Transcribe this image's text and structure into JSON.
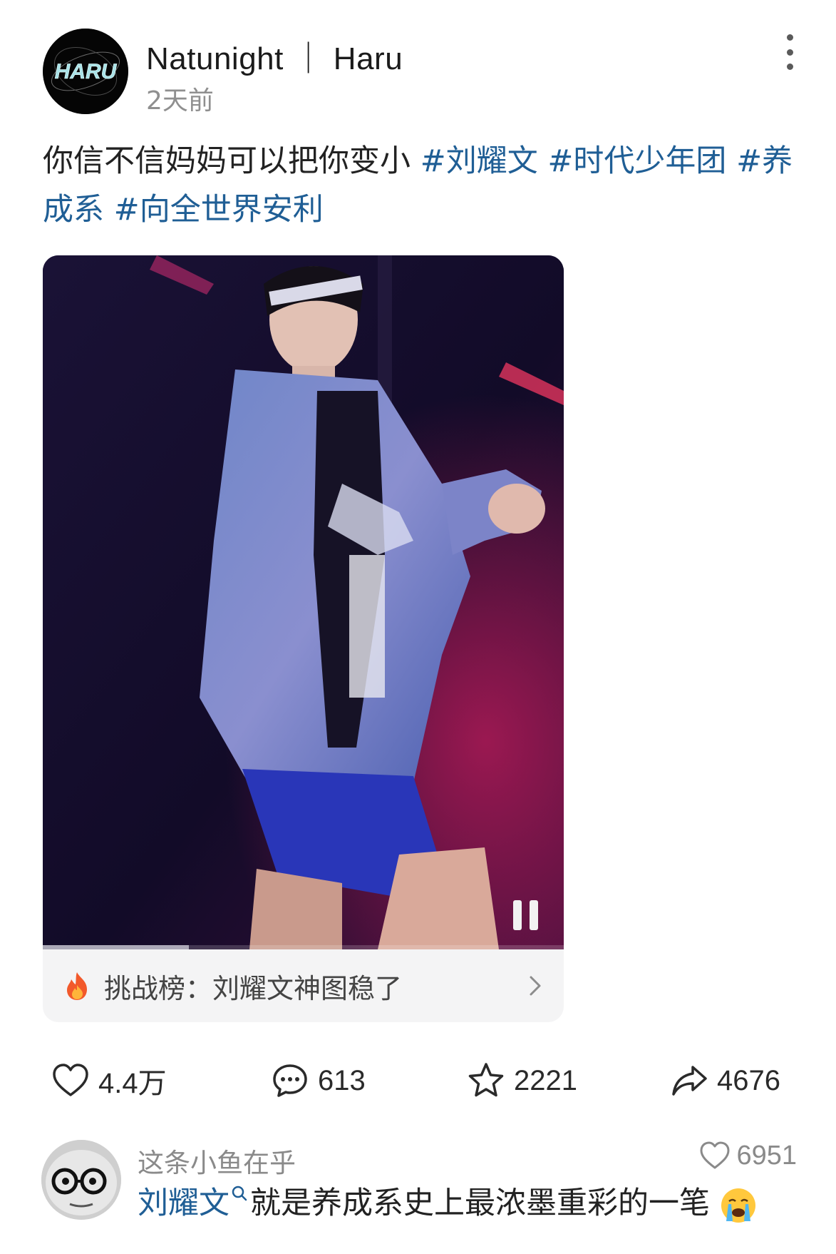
{
  "post": {
    "author": "Natunight ｜ Haru",
    "time": "2天前",
    "avatar_text": "HARU",
    "text": "你信不信妈妈可以把你变小",
    "tags": [
      "#刘耀文",
      "#时代少年团",
      "#养成系",
      "#向全世界安利"
    ]
  },
  "video": {
    "progress": 0.28,
    "state": "playing",
    "pause_icon": "pause-icon"
  },
  "challenge": {
    "icon": "fire-icon",
    "label": "挑战榜：刘耀文神图稳了"
  },
  "actions": {
    "like_count": "4.4万",
    "comment_count": "613",
    "favorite_count": "2221",
    "share_count": "4676"
  },
  "comment": {
    "user": "这条小鱼在乎",
    "likes": "6951",
    "mention": "刘耀文",
    "text": "就是养成系史上最浓墨重彩的一笔",
    "emoji": "crying-face-emoji"
  },
  "colors": {
    "link": "#1f5e95",
    "muted": "#8a8a8a"
  }
}
